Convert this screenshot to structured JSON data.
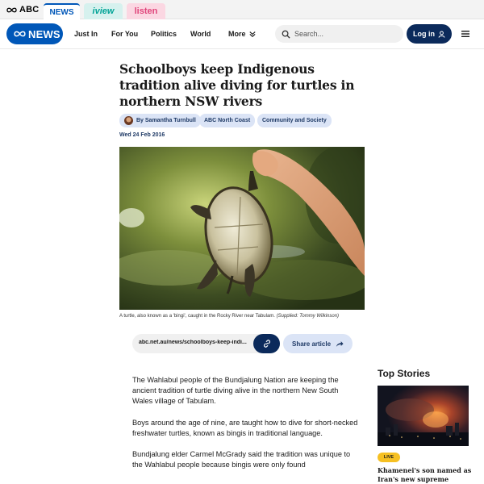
{
  "network_bar": {
    "brand": "ABC",
    "tabs": [
      {
        "label": "NEWS",
        "active": true
      },
      {
        "label": "iview",
        "active": false
      },
      {
        "label": "listen",
        "active": false
      }
    ]
  },
  "header": {
    "logo_text": "NEWS",
    "nav": [
      {
        "label": "Just In"
      },
      {
        "label": "For You"
      },
      {
        "label": "Politics"
      },
      {
        "label": "World"
      },
      {
        "label": "More"
      }
    ],
    "search_placeholder": "Search...",
    "login_label": "Log in"
  },
  "article": {
    "headline": "Schoolboys keep Indigenous tradition alive diving for turtles in northern NSW rivers",
    "tags": [
      {
        "label": "By Samantha Turnbull"
      },
      {
        "label": "ABC North Coast"
      },
      {
        "label": "Community and Society"
      }
    ],
    "date": "Wed 24 Feb 2016",
    "caption": "A turtle, also known as a 'bingi', caught in the Rocky River near Tabulam.",
    "caption_credit": "(Supplied: Tommy Wilkinson)",
    "share_url": "abc.net.au/news/schoolboys-keep-indi...",
    "share_label": "Share article",
    "paragraphs": [
      "The Wahlabul people of the Bundjalung Nation are keeping the ancient tradition of turtle diving alive in the northern New South Wales village of Tabulam.",
      "Boys around the age of nine, are taught how to dive for short-necked freshwater turtles, known as bingis in traditional language.",
      "Bundjalung elder Carmel McGrady said the tradition was unique to the Wahlabul people because bingis were only found"
    ]
  },
  "sidebar": {
    "title": "Top Stories",
    "story": {
      "badge": "LIVE",
      "headline": "Khamenei's son named as Iran's new supreme leader,"
    }
  },
  "colors": {
    "brand_blue": "#0057b8",
    "navy": "#0b2a5b",
    "tag_bg": "#dbe4f6",
    "live_yellow": "#f6c022",
    "iview_teal": "#00a396",
    "listen_pink": "#e0457b"
  },
  "icons": {
    "brand": "abc-lemniscate-icon",
    "more": "chevron-down-icon",
    "search": "search-icon",
    "login": "user-icon",
    "menu": "hamburger-menu-icon",
    "copy_link": "link-icon",
    "share": "share-arrow-icon"
  }
}
